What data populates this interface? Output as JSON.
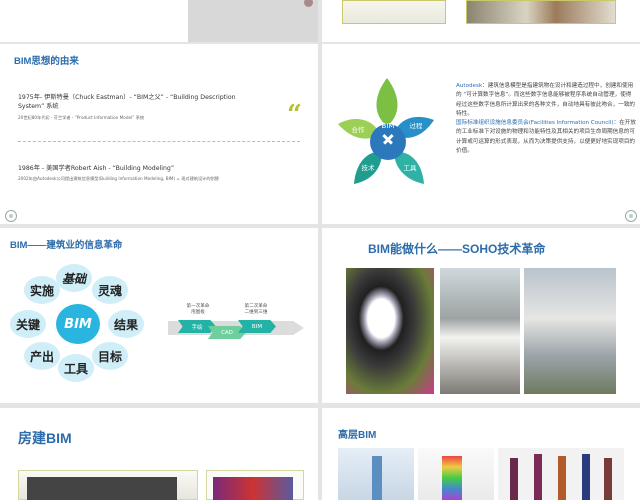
{
  "slide_top": {},
  "slide1": {
    "title": "BIM思想的由来",
    "entry1_title_a": "1975年- 伊斯特曼（Chuck Eastman）- “BIM之父” - “Building  Description",
    "entry1_title_b": "System” 系统",
    "entry1_sub": "20世纪80年代初 - 芬兰学者 - “Product Information Model” 系统",
    "entry2_title": "1986年 - 美国学者Robert Aish - “Building Modeling”",
    "entry2_sub": "2002年由Autodesk公司提出建筑信息模型(Building Information Modeling, BIM) = 现对建筑设计的划替",
    "quote_mark": "“"
  },
  "slide2": {
    "flower_center": "BIM",
    "petals": [
      "过程",
      "工具",
      "技术",
      "合作"
    ],
    "para1_brand": "Autodesk",
    "para1": "：建筑信息模型是指建筑物在设计和建造过程中，创建和使用的 “可计算数字信息”。而这些数字信息能够被程序系统自动管理，使得经过这些数字信息所计算出来的各种文件，自动地具有彼此吻合，一致的特性。",
    "para2_org": "国际标准组织设施信息委员会(Facilities Information Council)",
    "para2": "：在开放的工业标准下对设施的物理和功能特性及其相关的项目生命周期信息的可计算或可运算的形式表现，从而为决策提供支持，以便更好地实现项目的价值。"
  },
  "slide3": {
    "title": "BIM——建筑业的信息革命",
    "center": "BIM",
    "ring": [
      "基础",
      "灵魂",
      "结果",
      "目标",
      "工具",
      "产出",
      "关键",
      "实施"
    ],
    "rev1": "第一次革命\n甩图板",
    "rev2": "第二次革命\n二维到三维",
    "step1": "手绘",
    "step2": "CAD",
    "step3": "BIM"
  },
  "slide4": {
    "title": "BIM能做什么——SOHO技术革命"
  },
  "slide5": {
    "title": "房建BIM"
  },
  "slide6": {
    "title": "高层BIM"
  },
  "colors": {
    "accent": "#2d6dab",
    "teal": "#23b3a6",
    "green": "#7bc043"
  }
}
